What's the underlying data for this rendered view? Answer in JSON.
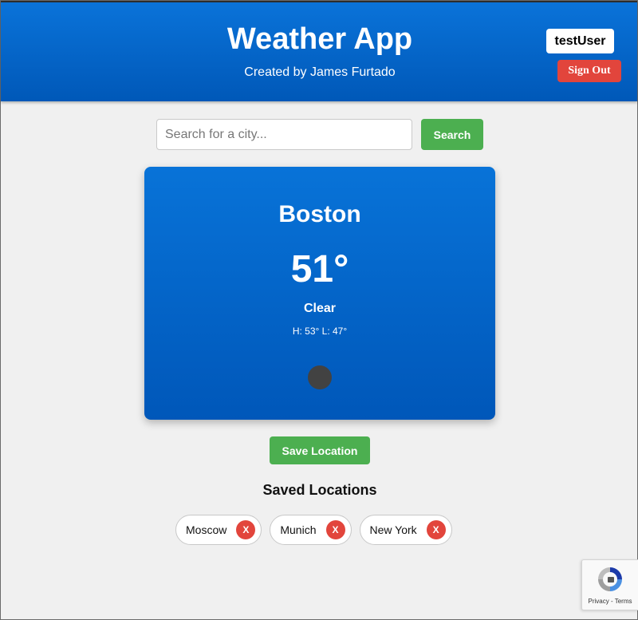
{
  "header": {
    "title": "Weather App",
    "subtitle": "Created by James Furtado",
    "username": "testUser",
    "sign_out_label": "Sign Out"
  },
  "search": {
    "placeholder": "Search for a city...",
    "value": "",
    "button_label": "Search"
  },
  "weather": {
    "city": "Boston",
    "temperature": "51°",
    "condition": "Clear",
    "high_low": "H: 53° L: 47°",
    "icon": "weather-condition-icon"
  },
  "save_button_label": "Save Location",
  "saved": {
    "title": "Saved Locations",
    "remove_label": "X",
    "locations": [
      {
        "name": "Moscow"
      },
      {
        "name": "Munich"
      },
      {
        "name": "New York"
      }
    ]
  },
  "recaptcha": {
    "links": "Privacy - Terms"
  },
  "colors": {
    "header_blue": "#0a73d9",
    "accent_green": "#4caf50",
    "danger_red": "#e2453c"
  }
}
